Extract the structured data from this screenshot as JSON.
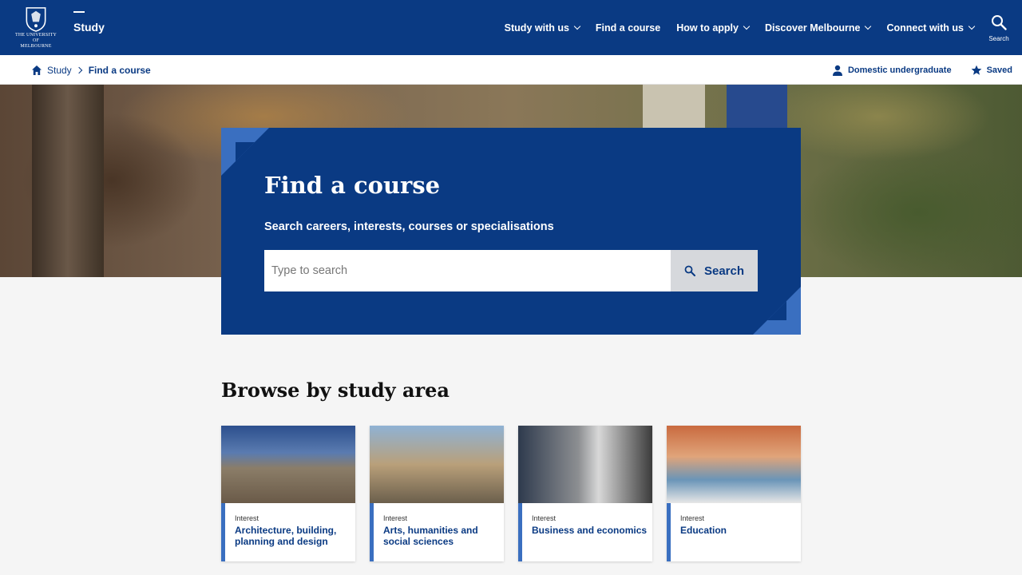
{
  "header": {
    "logo_text_line1": "THE UNIVERSITY OF",
    "logo_text_line2": "MELBOURNE",
    "site_name": "Study",
    "nav": [
      {
        "label": "Study with us",
        "dropdown": true
      },
      {
        "label": "Find a course",
        "dropdown": false
      },
      {
        "label": "How to apply",
        "dropdown": true
      },
      {
        "label": "Discover Melbourne",
        "dropdown": true
      },
      {
        "label": "Connect with us",
        "dropdown": true
      }
    ],
    "search_label": "Search"
  },
  "breadcrumb": {
    "items": [
      "Study",
      "Find a course"
    ],
    "profile_label": "Domestic undergraduate",
    "saved_label": "Saved"
  },
  "find": {
    "title": "Find a course",
    "subtitle": "Search careers, interests, courses or specialisations",
    "placeholder": "Type to search",
    "button_label": "Search"
  },
  "browse": {
    "title": "Browse by study area",
    "cards": [
      {
        "kicker": "Interest",
        "title": "Architecture, building, planning and design"
      },
      {
        "kicker": "Interest",
        "title": "Arts, humanities and social sciences"
      },
      {
        "kicker": "Interest",
        "title": "Business and economics"
      },
      {
        "kicker": "Interest",
        "title": "Education"
      }
    ]
  },
  "colors": {
    "brand_navy": "#0a3a83",
    "accent_blue": "#3a6fc0"
  }
}
